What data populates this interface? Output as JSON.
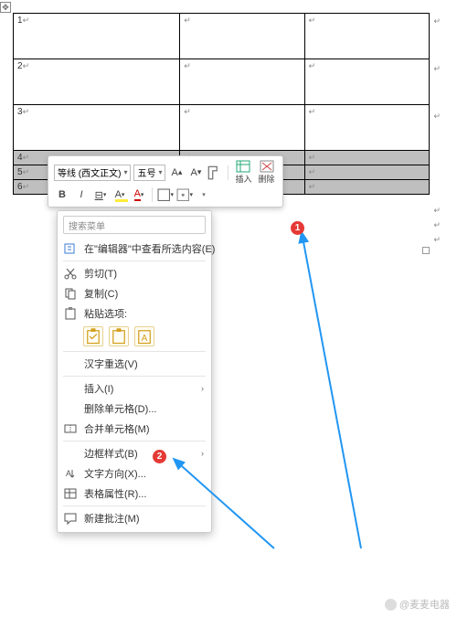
{
  "table": {
    "rows": [
      "1",
      "2",
      "3",
      "4",
      "5",
      "6"
    ]
  },
  "toolbar": {
    "font": "等线 (西文正文)",
    "size": "五号",
    "insert": "插入",
    "delete": "删除"
  },
  "menu": {
    "search": "搜索菜单",
    "lookup": "在\"编辑器\"中查看所选内容(E)",
    "cut": "剪切(T)",
    "copy": "复制(C)",
    "paste_opts": "粘贴选项:",
    "ime": "汉字重选(V)",
    "insert": "插入(I)",
    "delete_cells": "删除单元格(D)...",
    "merge": "合并单元格(M)",
    "border": "边框样式(B)",
    "text_dir": "文字方向(X)...",
    "table_props": "表格属性(R)...",
    "new_comment": "新建批注(M)"
  },
  "badges": {
    "b1": "1",
    "b2": "2"
  },
  "watermark": "@麦麦电器"
}
